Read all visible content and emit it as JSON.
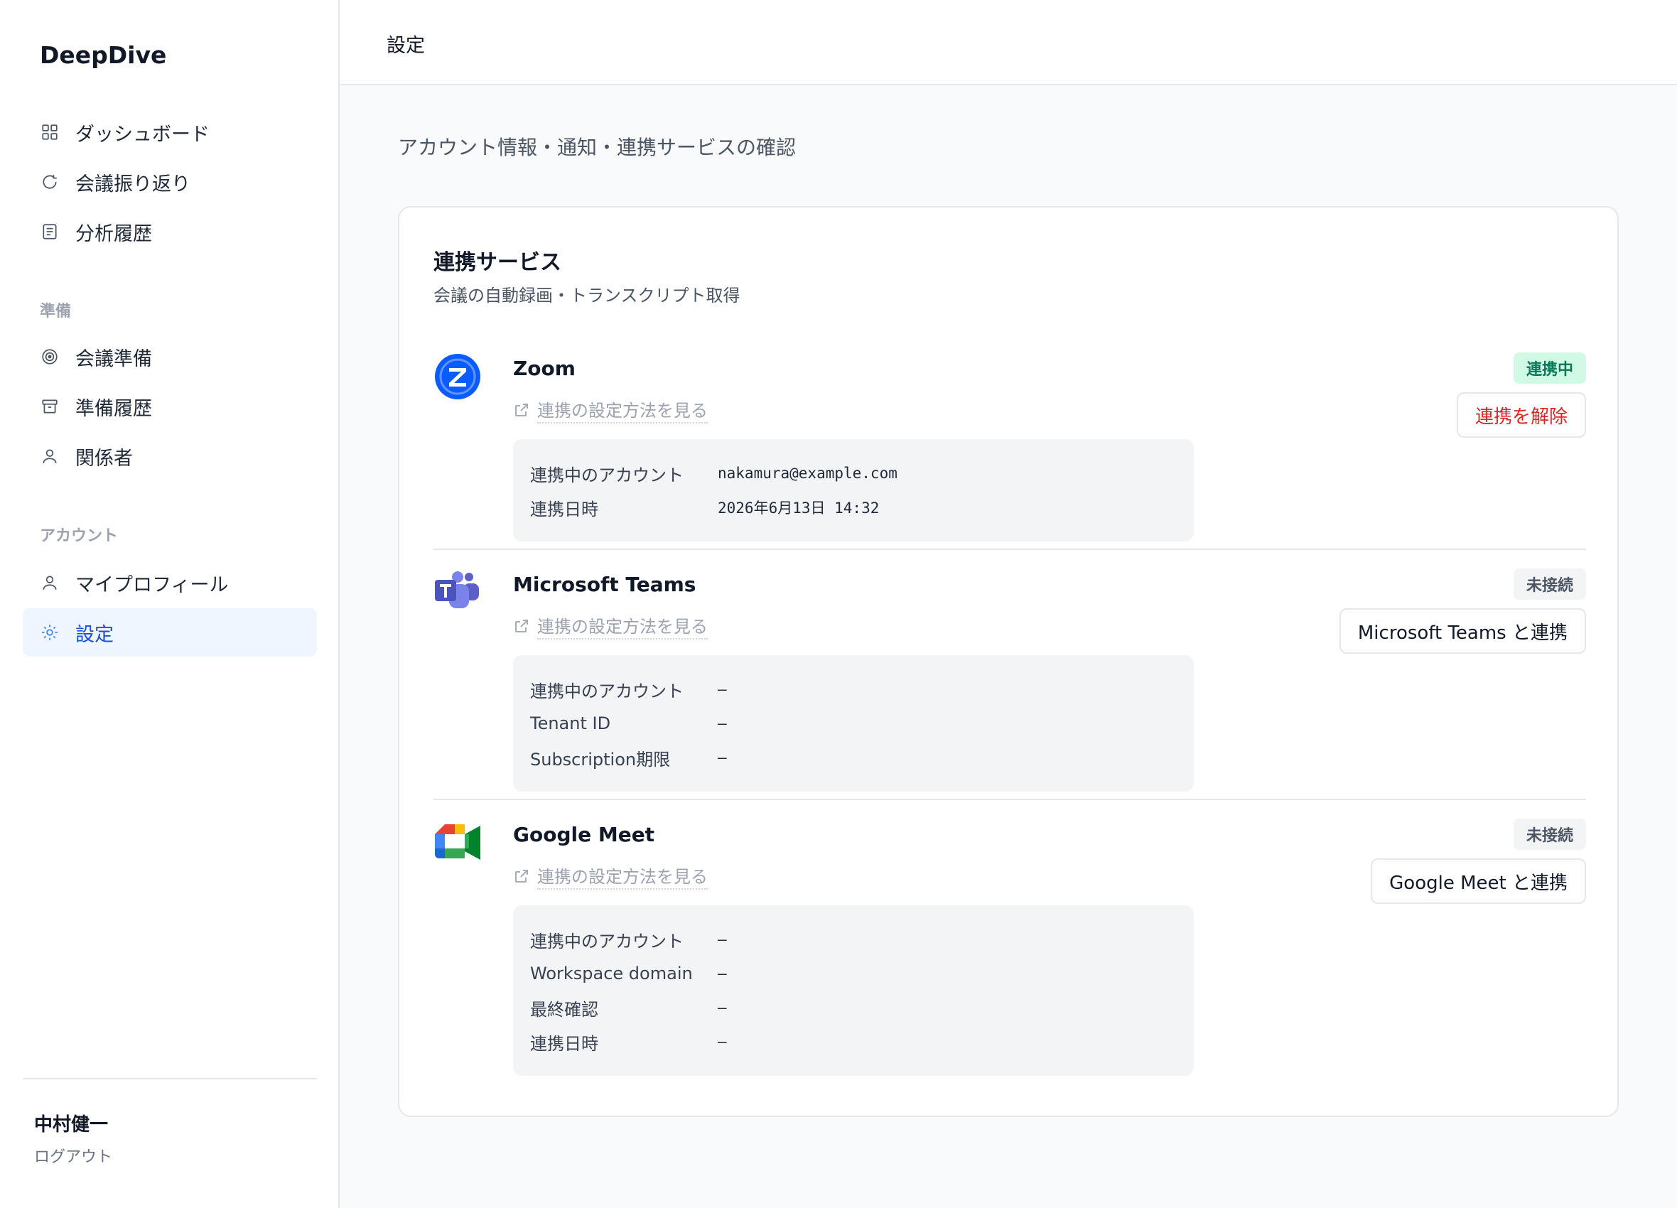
{
  "app": {
    "brand": "DeepDive"
  },
  "sidebar": {
    "main_items": [
      {
        "label": "ダッシュボード",
        "icon": "grid-icon"
      },
      {
        "label": "会議振り返り",
        "icon": "refresh-icon"
      },
      {
        "label": "分析履歴",
        "icon": "document-icon"
      }
    ],
    "prep_section": "準備",
    "prep_items": [
      {
        "label": "会議準備",
        "icon": "target-icon"
      },
      {
        "label": "準備履歴",
        "icon": "archive-icon"
      },
      {
        "label": "関係者",
        "icon": "user-icon"
      }
    ],
    "account_section": "アカウント",
    "account_items": [
      {
        "label": "マイプロフィール",
        "icon": "user-icon"
      },
      {
        "label": "設定",
        "icon": "gear-icon",
        "active": true
      }
    ],
    "user": {
      "name": "中村健一",
      "logout": "ログアウト"
    }
  },
  "header": {
    "title": "設定"
  },
  "page": {
    "subtitle": "アカウント情報・通知・連携サービスの確認"
  },
  "integrations": {
    "title": "連携サービス",
    "subtitle": "会議の自動録画・トランスクリプト取得",
    "help_label": "連携の設定方法を見る",
    "services": [
      {
        "name": "Zoom",
        "status": "連携中",
        "action": "連携を解除",
        "details": [
          {
            "key": "連携中のアカウント",
            "value": "nakamura@example.com"
          },
          {
            "key": "連携日時",
            "value": "2026年6月13日 14:32"
          }
        ]
      },
      {
        "name": "Microsoft Teams",
        "status": "未接続",
        "action": "Microsoft Teams と連携",
        "details": [
          {
            "key": "連携中のアカウント",
            "value": "—"
          },
          {
            "key": "Tenant ID",
            "value": "—"
          },
          {
            "key": "Subscription期限",
            "value": "—"
          }
        ]
      },
      {
        "name": "Google Meet",
        "status": "未接続",
        "action": "Google Meet と連携",
        "details": [
          {
            "key": "連携中のアカウント",
            "value": "—"
          },
          {
            "key": "Workspace domain",
            "value": "—"
          },
          {
            "key": "最終確認",
            "value": "—"
          },
          {
            "key": "連携日時",
            "value": "—"
          }
        ]
      }
    ]
  },
  "colors": {
    "accent": "#1d4ed8",
    "connected": "#047857",
    "danger": "#dc2626"
  }
}
